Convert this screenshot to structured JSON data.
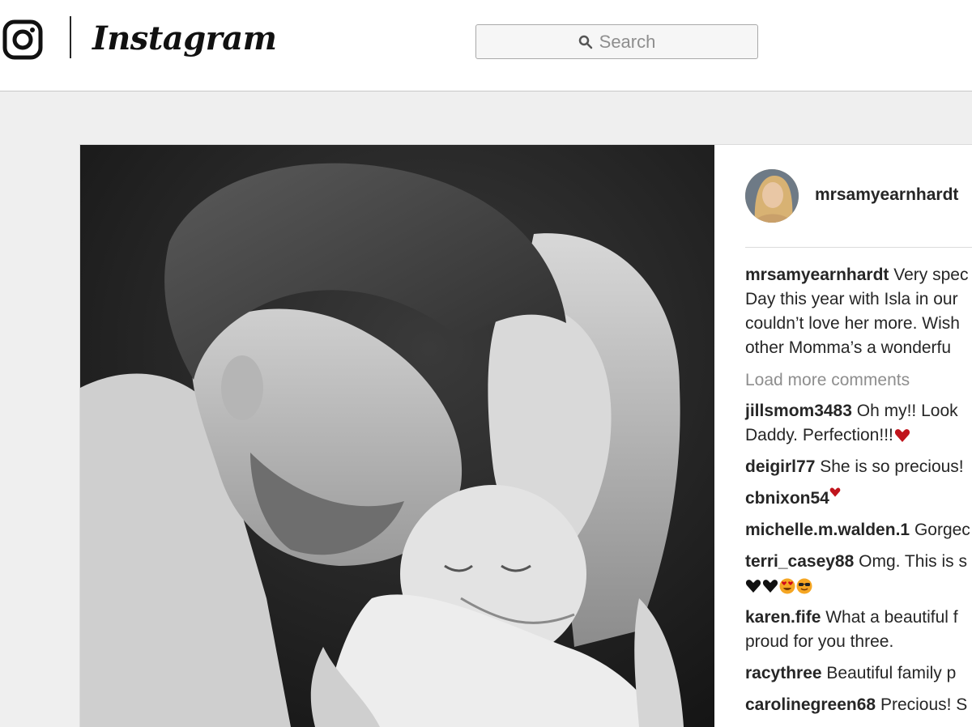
{
  "header": {
    "logo_icon": "instagram-camera-icon",
    "wordmark": "Instagram",
    "search": {
      "icon": "search-icon",
      "placeholder": "Search"
    }
  },
  "post": {
    "author": {
      "username": "mrsamyearnhardt",
      "avatar_icon": "avatar-photo",
      "verified_icon": "verified-badge-icon"
    },
    "caption": {
      "user": "mrsamyearnhardt",
      "lines": [
        "Very spec",
        "Day this year with Isla in our",
        "couldn’t love her more. Wish",
        "other Momma’s a wonderfu"
      ]
    },
    "load_more": "Load more comments",
    "comments": [
      {
        "user": "jillsmom3483",
        "lines": [
          "Oh my!! Look",
          "Daddy. Perfection!!!"
        ],
        "emojis": [
          "heart-red"
        ]
      },
      {
        "user": "deigirl77",
        "lines": [
          "She is so precious!"
        ],
        "emojis": []
      },
      {
        "user": "cbnixon54",
        "lines": [
          ""
        ],
        "emojis": [
          "heart-red"
        ]
      },
      {
        "user": "michelle.m.walden.1",
        "lines": [
          "Gorgec"
        ],
        "emojis": []
      },
      {
        "user": "terri_casey88",
        "lines": [
          "Omg. This is s",
          ""
        ],
        "emojis": [
          "heart-black",
          "heart-black",
          "heart-eyes-face",
          "sunglasses-face"
        ]
      },
      {
        "user": "karen.fife",
        "lines": [
          "What a beautiful f",
          "proud for you three."
        ],
        "emojis": []
      },
      {
        "user": "racythree",
        "lines": [
          "Beautiful family p"
        ],
        "emojis": []
      },
      {
        "user": "carolinegreen68",
        "lines": [
          "Precious! S"
        ],
        "emojis": []
      }
    ]
  },
  "colors": {
    "background": "#efefef",
    "text": "#262626",
    "muted": "#8e8e8e",
    "verified": "#3897f0",
    "heart": "#c0141c"
  }
}
